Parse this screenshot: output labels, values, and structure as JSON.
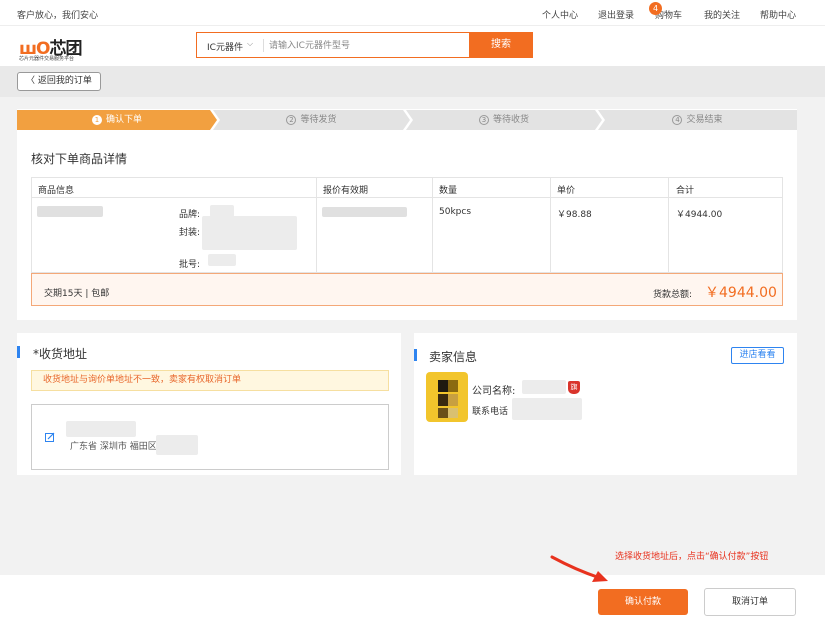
{
  "topbar": {
    "slogan": "客户放心，我们安心",
    "nav": [
      "个人中心",
      "退出登录",
      "购物车",
      "我的关注",
      "帮助中心"
    ],
    "cart_count": "4"
  },
  "header": {
    "logo_text": "芯团",
    "logo_sub": "芯片元器件交易服务平台",
    "search_category": "IC元器件",
    "search_placeholder": "请输入IC元器件型号",
    "search_button": "搜索"
  },
  "back_button": "返回我的订单",
  "steps": [
    {
      "num": "1",
      "label": "确认下单",
      "active": true
    },
    {
      "num": "2",
      "label": "等待发货",
      "active": false
    },
    {
      "num": "3",
      "label": "等待收货",
      "active": false
    },
    {
      "num": "4",
      "label": "交易结束",
      "active": false
    }
  ],
  "order": {
    "title": "核对下单商品详情",
    "columns": [
      "商品信息",
      "报价有效期",
      "数量",
      "单价",
      "合计"
    ],
    "item": {
      "brand_label": "品牌:",
      "package_label": "封装:",
      "batch_label": "批号:",
      "quantity": "50kpcs",
      "unit_price": "￥98.88",
      "subtotal": "￥4944.00"
    },
    "delivery": "交期15天 | 包邮",
    "total_label": "货款总额:",
    "total": "￥4944.00"
  },
  "address": {
    "title": "*收货地址",
    "warning": "收货地址与询价单地址不一致，卖家有权取消订单",
    "text": "广东省 深圳市 福田区"
  },
  "seller": {
    "title": "卖家信息",
    "visit_button": "进店看看",
    "company_label": "公司名称:",
    "phone_label": "联系电话",
    "flag": "旗"
  },
  "annotation": "选择收货地址后，点击“确认付款”按钮",
  "actions": {
    "pay": "确认付款",
    "cancel": "取消订单"
  },
  "colors": {
    "accent": "#f26d21",
    "step_active": "#f2a040",
    "step_inactive": "#e3e3e3",
    "link_blue": "#2e84f0",
    "annotation_red": "#e8321e"
  }
}
